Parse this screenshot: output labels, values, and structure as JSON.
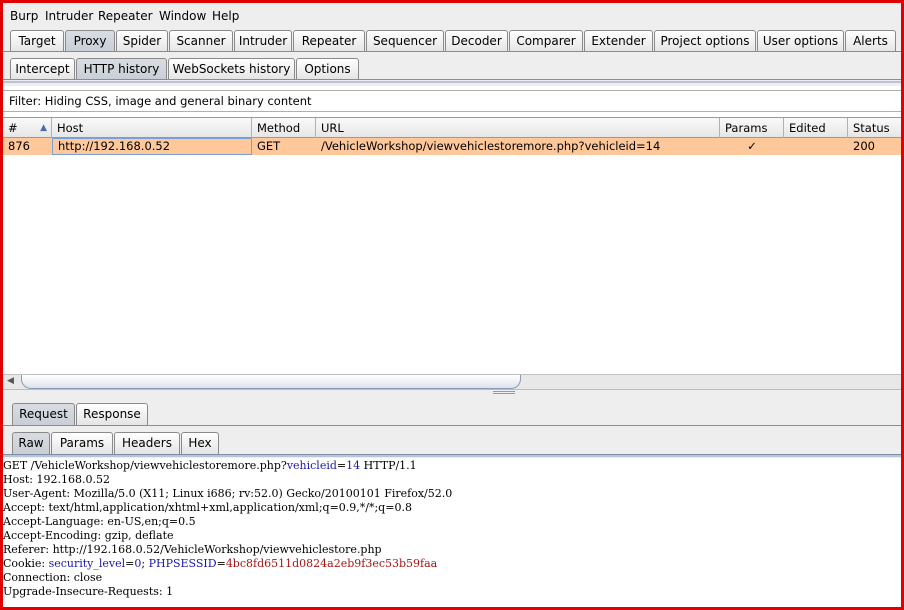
{
  "menu": [
    "Burp",
    "Intruder",
    "Repeater",
    "Window",
    "Help"
  ],
  "main_tabs": [
    "Target",
    "Proxy",
    "Spider",
    "Scanner",
    "Intruder",
    "Repeater",
    "Sequencer",
    "Decoder",
    "Comparer",
    "Extender",
    "Project options",
    "User options",
    "Alerts"
  ],
  "main_selected": "Proxy",
  "proxy_tabs": [
    "Intercept",
    "HTTP history",
    "WebSockets history",
    "Options"
  ],
  "proxy_selected": "HTTP history",
  "filter_text": "Filter: Hiding CSS, image and general binary content",
  "table": {
    "columns": [
      "#",
      "Host",
      "Method",
      "URL",
      "Params",
      "Edited",
      "Status"
    ],
    "sort_glyph": "▲",
    "rows": [
      {
        "num": "876",
        "host": "http://192.168.0.52",
        "method": "GET",
        "url": "/VehicleWorkshop/viewvehiclestoremore.php?vehicleid=14",
        "params": "✓",
        "edited": "",
        "status": "200"
      }
    ]
  },
  "scroll_arrow": "◀",
  "message_tabs": [
    "Request",
    "Response"
  ],
  "message_selected": "Request",
  "view_tabs": [
    "Raw",
    "Params",
    "Headers",
    "Hex"
  ],
  "view_selected": "Raw",
  "request": {
    "line1_pre": "GET /VehicleWorkshop/viewvehiclestoremore.php?",
    "line1_param": "vehicleid",
    "line1_eq": "=",
    "line1_value": "14",
    "line1_post": " HTTP/1.1",
    "host": "Host: 192.168.0.52",
    "user_agent": "User-Agent: Mozilla/5.0 (X11; Linux i686; rv:52.0) Gecko/20100101 Firefox/52.0",
    "accept": "Accept: text/html,application/xhtml+xml,application/xml;q=0.9,*/*;q=0.8",
    "accept_language": "Accept-Language: en-US,en;q=0.5",
    "accept_encoding": "Accept-Encoding: gzip, deflate",
    "referer": "Referer: http://192.168.0.52/VehicleWorkshop/viewvehiclestore.php",
    "cookie_pre": "Cookie: ",
    "cookie1_name": "security_level",
    "cookie1_eq": "=",
    "cookie1_value": "0",
    "cookie_sep": "; ",
    "cookie2_name": "PHPSESSID",
    "cookie2_eq": "=",
    "cookie2_value": "4bc8fd6511d0824a2eb9f3ec53b59faa",
    "connection": "Connection: close",
    "upgrade": "Upgrade-Insecure-Requests: 1"
  }
}
